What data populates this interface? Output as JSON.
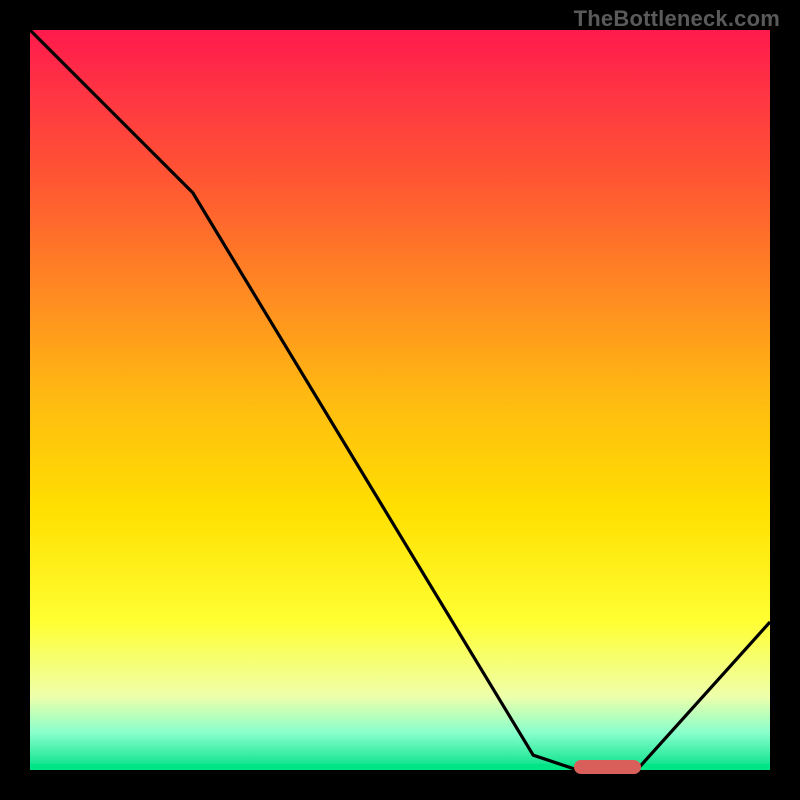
{
  "watermark": "TheBottleneck.com",
  "colors": {
    "curve": "#000000",
    "marker": "#d9605a",
    "frame": "#000000"
  },
  "chart_data": {
    "type": "line",
    "title": "",
    "xlabel": "",
    "ylabel": "",
    "xlim": [
      0,
      100
    ],
    "ylim": [
      0,
      100
    ],
    "grid": false,
    "legend": false,
    "series": [
      {
        "name": "bottleneck-curve",
        "x": [
          0,
          22,
          68,
          74,
          82,
          100
        ],
        "values": [
          100,
          78,
          2,
          0,
          0,
          20
        ]
      }
    ],
    "marker": {
      "x_start": 74,
      "x_end": 82,
      "y": 0
    }
  }
}
